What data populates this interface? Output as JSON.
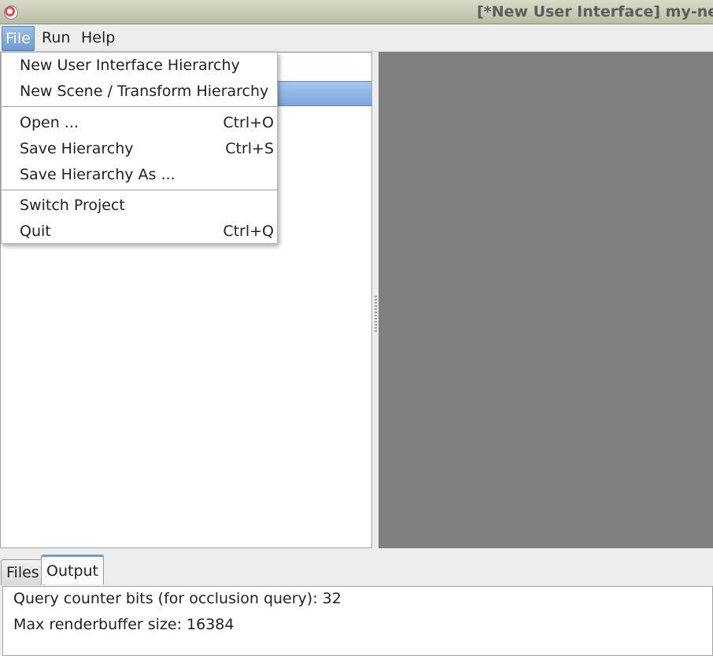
{
  "window": {
    "title": "[*New User Interface] my-ne"
  },
  "menubar": {
    "file": "File",
    "run": "Run",
    "help": "Help"
  },
  "file_menu": {
    "items": [
      {
        "label": "New User Interface Hierarchy",
        "shortcut": ""
      },
      {
        "label": "New Scene / Transform Hierarchy",
        "shortcut": ""
      },
      {
        "label": "Open ...",
        "shortcut": "Ctrl+O"
      },
      {
        "label": "Save Hierarchy",
        "shortcut": "Ctrl+S"
      },
      {
        "label": "Save Hierarchy As ...",
        "shortcut": ""
      },
      {
        "label": "Switch Project",
        "shortcut": ""
      },
      {
        "label": "Quit",
        "shortcut": "Ctrl+Q"
      }
    ]
  },
  "bottom_tabs": {
    "files": "Files",
    "output": "Output"
  },
  "output": {
    "lines": [
      "Query counter bits (for occlusion query): 32",
      "Max renderbuffer size: 16384"
    ]
  },
  "colors": {
    "accent": "#6d9bd0",
    "viewport": "#808080"
  }
}
